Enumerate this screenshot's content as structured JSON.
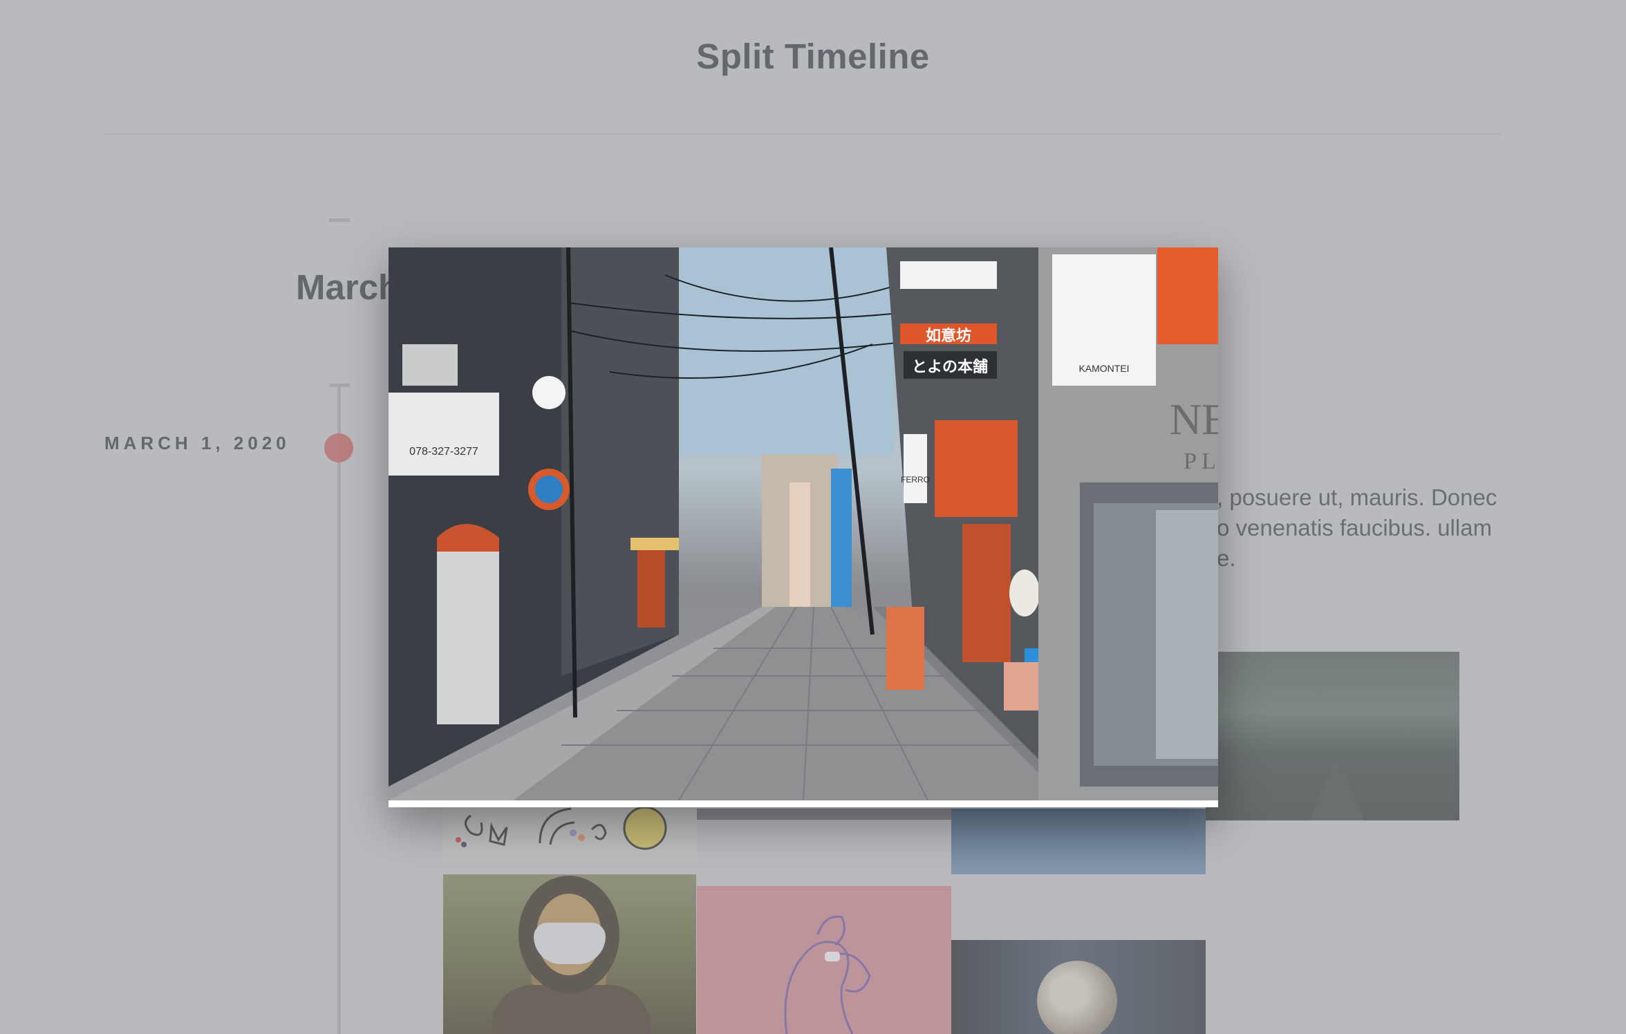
{
  "page": {
    "title": "Split Timeline",
    "month_heading": "March",
    "entry": {
      "date": "MARCH 1, 2020",
      "text_lines": [
        ", posuere ut, mauris. Donec",
        "o venenatis faucibus. ullam",
        "e."
      ]
    }
  },
  "lightbox": {
    "visible": true,
    "signs": {
      "phone": "078-327-3277",
      "shop_1": "如意坊",
      "shop_2": "とよの本舗",
      "plaza": "NER",
      "plaza_2": "P L A Z",
      "kamontei": "KAMONTEI",
      "ferro": "FERRO"
    }
  },
  "colors": {
    "background": "#c1c2c4",
    "accent_dot": "#c25a5a",
    "title_text": "#30333b"
  }
}
